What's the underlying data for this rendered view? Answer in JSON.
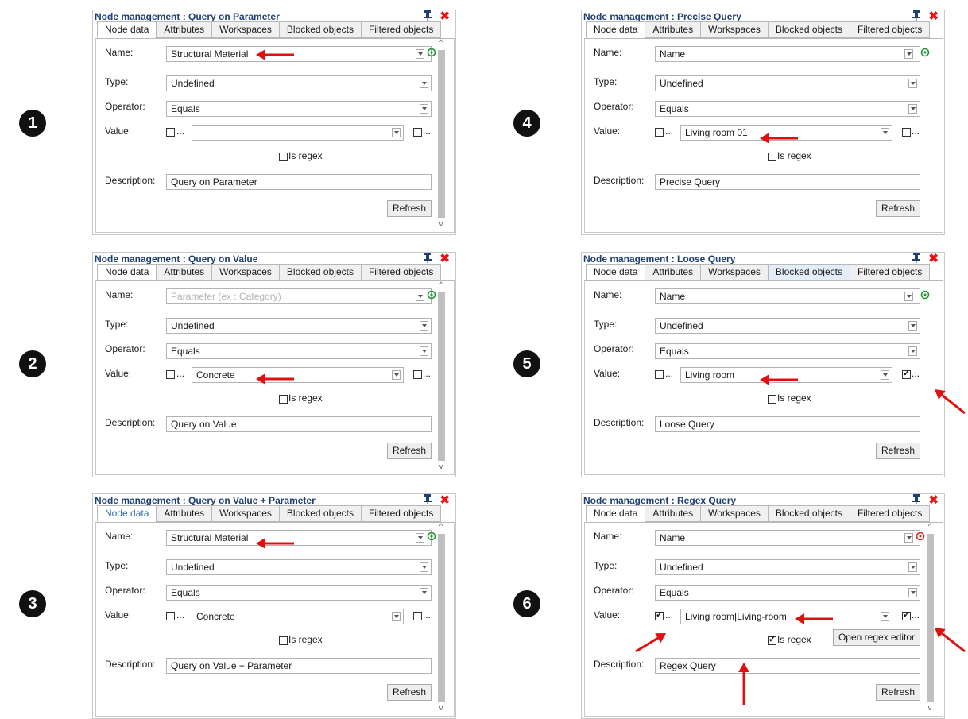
{
  "badges": [
    "1",
    "2",
    "3",
    "4",
    "5",
    "6"
  ],
  "common": {
    "tabs": [
      "Node data",
      "Attributes",
      "Workspaces",
      "Blocked objects",
      "Filtered objects"
    ],
    "name_label": "Name:",
    "type_label": "Type:",
    "operator_label": "Operator:",
    "value_label": "Value:",
    "description_label": "Description:",
    "type_value": "Undefined",
    "operator_value": "Equals",
    "is_regex_label": "Is regex",
    "dots": "...",
    "refresh_label": "Refresh"
  },
  "panels": [
    {
      "title": "Node management : Query on Parameter",
      "name": "Structural Material",
      "name_is_placeholder": false,
      "value": "",
      "value_left_checked": false,
      "value_right_checked": false,
      "is_regex": false,
      "description": "Query on Parameter",
      "has_scrollbar": true,
      "open_regex": ""
    },
    {
      "title": "Node management : Query on Value",
      "name": "Parameter (ex : Category)",
      "name_is_placeholder": true,
      "value": "Concrete",
      "value_left_checked": false,
      "value_right_checked": false,
      "is_regex": false,
      "description": "Query on Value",
      "has_scrollbar": true,
      "open_regex": ""
    },
    {
      "title": "Node management : Query on Value + Parameter",
      "name": "Structural Material",
      "name_is_placeholder": false,
      "value": "Concrete",
      "value_left_checked": false,
      "value_right_checked": false,
      "is_regex": false,
      "description": "Query on Value + Parameter",
      "has_scrollbar": true,
      "open_regex": ""
    },
    {
      "title": "Node management : Precise Query",
      "name": "Name",
      "name_is_placeholder": false,
      "value": "Living room 01",
      "value_left_checked": false,
      "value_right_checked": false,
      "is_regex": false,
      "description": "Precise Query",
      "has_scrollbar": false,
      "open_regex": ""
    },
    {
      "title": "Node management : Loose Query",
      "name": "Name",
      "name_is_placeholder": false,
      "value": "Living room",
      "value_left_checked": false,
      "value_right_checked": true,
      "is_regex": false,
      "description": "Loose Query",
      "has_scrollbar": false,
      "open_regex": ""
    },
    {
      "title": "Node management : Regex Query",
      "name": "Name",
      "name_is_placeholder": false,
      "value": "Living room|Living-room",
      "value_left_checked": true,
      "value_right_checked": true,
      "is_regex": true,
      "description": "Regex Query",
      "has_scrollbar": true,
      "open_regex": "Open regex editor"
    }
  ],
  "colors": {
    "title": "#1d3f73",
    "close": "#e11111",
    "arrow": "#e01010",
    "target_ok": "#1a9a2a",
    "target_err": "#d62020",
    "active_tab_blue": "#2a6bb5",
    "tab_highlight": "#e4eefa"
  },
  "icons": {
    "pin": "pin-icon",
    "close": "close-icon",
    "target": "target-icon",
    "arrow": "red-arrow-annotation"
  }
}
